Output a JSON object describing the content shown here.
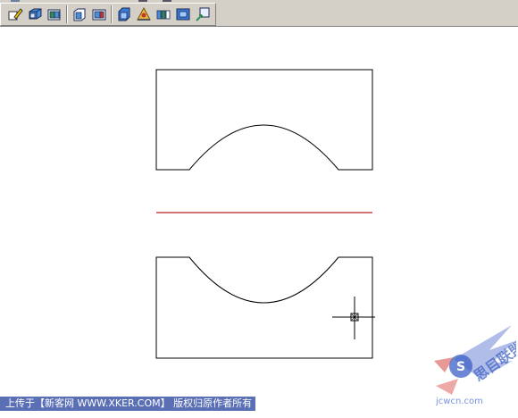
{
  "toolbar": {
    "buttons": [
      {
        "icon": "draw-order-icon"
      },
      {
        "icon": "solid-box-icon"
      },
      {
        "icon": "solid-wedge-icon"
      },
      {
        "icon": "solid-cone-icon"
      },
      {
        "icon": "solid-cylinder-icon"
      },
      {
        "icon": "shade-icon"
      },
      {
        "icon": "render-icon"
      },
      {
        "icon": "materials-icon"
      },
      {
        "icon": "view-icon"
      },
      {
        "icon": "refresh-icon"
      }
    ]
  },
  "colors": {
    "outline": "#000000",
    "center_line": "#b22222",
    "watermark_bg": "#5a6fb4",
    "logo_blue": "#3b5fc4",
    "logo_red": "#d9534f"
  },
  "watermark": {
    "text": "上传于【新客网 WWW.XKER.COM】 版权归原作者所有",
    "logo_text": "思目联盟",
    "logo_url": "jcwcn.com"
  },
  "cursor": {
    "icon": "crosshair-cursor-icon"
  }
}
